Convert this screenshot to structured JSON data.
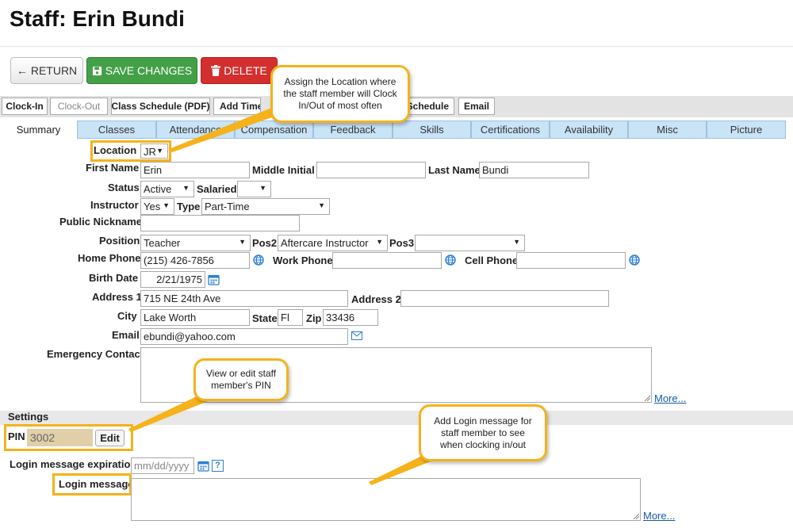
{
  "page": {
    "title": "Staff: Erin Bundi"
  },
  "actions": {
    "return": "RETURN",
    "save": "SAVE CHANGES",
    "delete": "DELETE"
  },
  "toolbar": {
    "clock_in": "Clock-In",
    "clock_out": "Clock-Out",
    "class_schedule": "Class Schedule (PDF)",
    "add_time": "Add Time",
    "schedule": "Schedule",
    "email": "Email"
  },
  "tabs": [
    "Summary",
    "Classes",
    "Attendance",
    "Compensation",
    "Feedback",
    "Skills",
    "Certifications",
    "Availability",
    "Misc",
    "Picture"
  ],
  "form": {
    "location": {
      "label": "Location",
      "value": "JR"
    },
    "first_name": {
      "label": "First Name",
      "value": "Erin"
    },
    "middle_initial": {
      "label": "Middle Initial",
      "value": ""
    },
    "last_name": {
      "label": "Last Name",
      "value": "Bundi"
    },
    "status": {
      "label": "Status",
      "value": "Active"
    },
    "salaried": {
      "label": "Salaried",
      "value": ""
    },
    "instructor": {
      "label": "Instructor",
      "value": "Yes"
    },
    "type": {
      "label": "Type",
      "value": "Part-Time"
    },
    "public_nickname": {
      "label": "Public Nickname",
      "value": ""
    },
    "position": {
      "label": "Position",
      "value": "Teacher"
    },
    "pos2": {
      "label": "Pos2",
      "value": "Aftercare Instructor"
    },
    "pos3": {
      "label": "Pos3",
      "value": ""
    },
    "home_phone": {
      "label": "Home Phone",
      "value": "(215) 426-7856"
    },
    "work_phone": {
      "label": "Work Phone",
      "value": ""
    },
    "cell_phone": {
      "label": "Cell Phone",
      "value": ""
    },
    "birth_date": {
      "label": "Birth Date",
      "value": "2/21/1975"
    },
    "address1": {
      "label": "Address 1",
      "value": "715 NE 24th Ave"
    },
    "address2": {
      "label": "Address 2",
      "value": ""
    },
    "city": {
      "label": "City",
      "value": "Lake Worth"
    },
    "state": {
      "label": "State",
      "value": "Fl"
    },
    "zip": {
      "label": "Zip",
      "value": "33436"
    },
    "email": {
      "label": "Email",
      "value": "ebundi@yahoo.com"
    },
    "emergency_contact": {
      "label": "Emergency Contact",
      "more": "More..."
    }
  },
  "settings": {
    "header": "Settings",
    "pin_label": "PIN",
    "pin_value": "3002",
    "edit": "Edit",
    "login_expiration_label": "Login message expiration",
    "login_expiration_placeholder": "mm/dd/yyyy",
    "help": "?",
    "login_message_label": "Login message",
    "more": "More..."
  },
  "callouts": {
    "location": "Assign the Location where the staff member will Clock In/Out of most often",
    "pin": "View or edit staff member's PIN",
    "login": "Add Login message for staff member to see when clocking in/out"
  },
  "colors": {
    "save": "#43a047",
    "delete": "#d32f2f",
    "tab": "#c9e3f7",
    "callout": "#f5b21b",
    "link": "#1a5aa8"
  }
}
